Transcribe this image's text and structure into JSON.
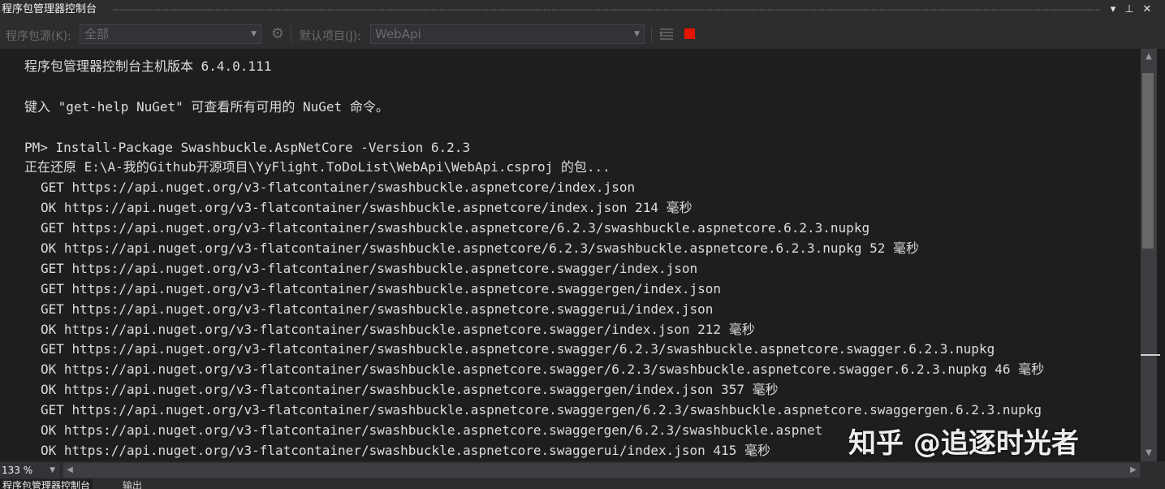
{
  "window": {
    "title": "程序包管理器控制台",
    "buttons": [
      "▾",
      "⊥",
      "✕"
    ]
  },
  "toolbar": {
    "source_label": "程序包源(K):",
    "source_value": "全部",
    "default_project_label": "默认项目(J):",
    "default_project_value": "WebApi",
    "icons": [
      "settings-gear-icon",
      "clear-console-icon",
      "stop-icon"
    ],
    "stop_color": "#e51400"
  },
  "console": {
    "lines": [
      {
        "text": "程序包管理器控制台主机版本 6.4.0.111",
        "indent": false
      },
      {
        "text": "",
        "indent": false
      },
      {
        "text": "键入 \"get-help NuGet\" 可查看所有可用的 NuGet 命令。",
        "indent": false
      },
      {
        "text": "",
        "indent": false
      },
      {
        "text": "PM> Install-Package Swashbuckle.AspNetCore -Version 6.2.3",
        "indent": false
      },
      {
        "text": "正在还原 E:\\A-我的Github开源项目\\YyFlight.ToDoList\\WebApi\\WebApi.csproj 的包...",
        "indent": false
      },
      {
        "text": "GET https://api.nuget.org/v3-flatcontainer/swashbuckle.aspnetcore/index.json",
        "indent": true
      },
      {
        "text": "OK https://api.nuget.org/v3-flatcontainer/swashbuckle.aspnetcore/index.json 214 毫秒",
        "indent": true
      },
      {
        "text": "GET https://api.nuget.org/v3-flatcontainer/swashbuckle.aspnetcore/6.2.3/swashbuckle.aspnetcore.6.2.3.nupkg",
        "indent": true
      },
      {
        "text": "OK https://api.nuget.org/v3-flatcontainer/swashbuckle.aspnetcore/6.2.3/swashbuckle.aspnetcore.6.2.3.nupkg 52 毫秒",
        "indent": true
      },
      {
        "text": "GET https://api.nuget.org/v3-flatcontainer/swashbuckle.aspnetcore.swagger/index.json",
        "indent": true
      },
      {
        "text": "GET https://api.nuget.org/v3-flatcontainer/swashbuckle.aspnetcore.swaggergen/index.json",
        "indent": true
      },
      {
        "text": "GET https://api.nuget.org/v3-flatcontainer/swashbuckle.aspnetcore.swaggerui/index.json",
        "indent": true
      },
      {
        "text": "OK https://api.nuget.org/v3-flatcontainer/swashbuckle.aspnetcore.swagger/index.json 212 毫秒",
        "indent": true
      },
      {
        "text": "GET https://api.nuget.org/v3-flatcontainer/swashbuckle.aspnetcore.swagger/6.2.3/swashbuckle.aspnetcore.swagger.6.2.3.nupkg",
        "indent": true
      },
      {
        "text": "OK https://api.nuget.org/v3-flatcontainer/swashbuckle.aspnetcore.swagger/6.2.3/swashbuckle.aspnetcore.swagger.6.2.3.nupkg 46 毫秒",
        "indent": true
      },
      {
        "text": "OK https://api.nuget.org/v3-flatcontainer/swashbuckle.aspnetcore.swaggergen/index.json 357 毫秒",
        "indent": true
      },
      {
        "text": "GET https://api.nuget.org/v3-flatcontainer/swashbuckle.aspnetcore.swaggergen/6.2.3/swashbuckle.aspnetcore.swaggergen.6.2.3.nupkg",
        "indent": true
      },
      {
        "text": "OK https://api.nuget.org/v3-flatcontainer/swashbuckle.aspnetcore.swaggergen/6.2.3/swashbuckle.aspnet",
        "indent": true
      },
      {
        "text": "OK https://api.nuget.org/v3-flatcontainer/swashbuckle.aspnetcore.swaggerui/index.json 415 毫秒",
        "indent": true
      }
    ]
  },
  "statusbar": {
    "zoom": "133 %"
  },
  "tabs": [
    {
      "label": "程序包管理器控制台",
      "active": true
    },
    {
      "label": "输出",
      "active": false
    }
  ],
  "watermark": "知乎 @追逐时光者"
}
